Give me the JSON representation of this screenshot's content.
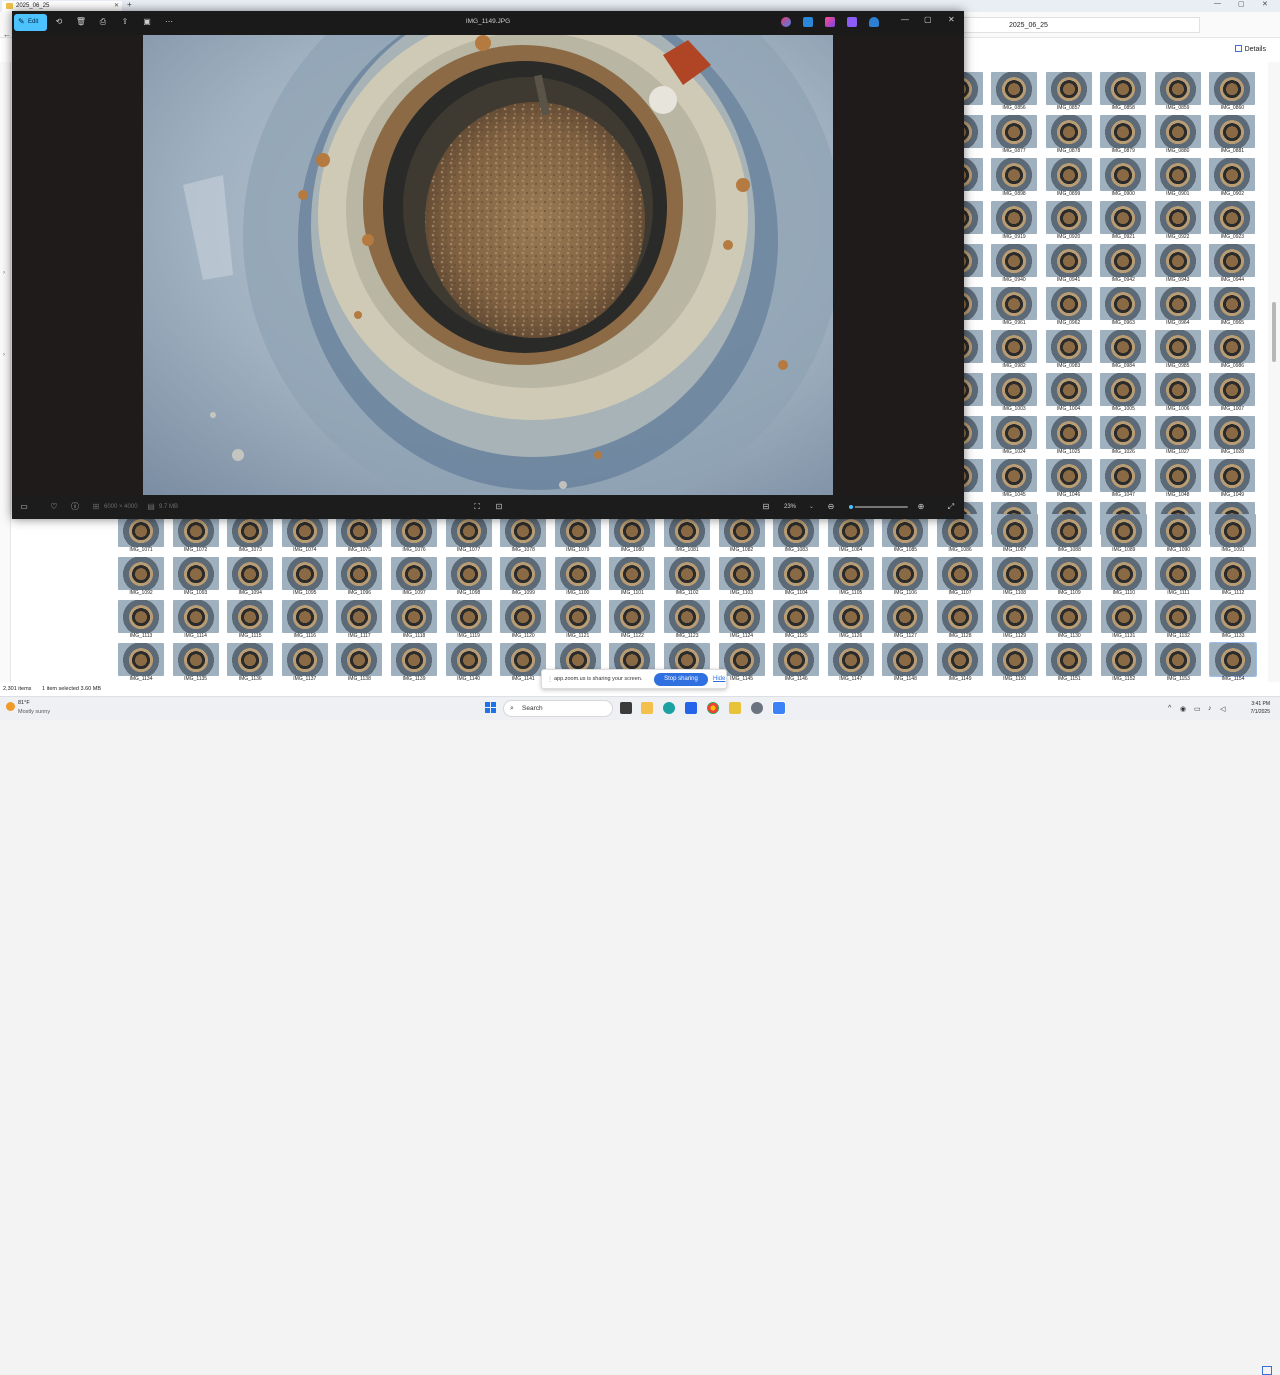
{
  "explorer": {
    "tab_title": "2025_06_25",
    "address_path": "2025_06_25",
    "details_label": "Details",
    "status_count": "2,301 items",
    "status_selected": "1 item selected  3.60 MB",
    "thumbnails_right": [
      [
        "IMG_0856",
        "IMG_0857",
        "IMG_0858",
        "IMG_0859",
        "IMG_0860"
      ],
      [
        "IMG_0877",
        "IMG_0878",
        "IMG_0879",
        "IMG_0880",
        "IMG_0881"
      ],
      [
        "IMG_0898",
        "IMG_0899",
        "IMG_0900",
        "IMG_0901",
        "IMG_0902"
      ],
      [
        "IMG_0919",
        "IMG_0920",
        "IMG_0921",
        "IMG_0922",
        "IMG_0923"
      ],
      [
        "IMG_0940",
        "IMG_0941",
        "IMG_0942",
        "IMG_0943",
        "IMG_0944"
      ],
      [
        "IMG_0961",
        "IMG_0962",
        "IMG_0963",
        "IMG_0964",
        "IMG_0965"
      ],
      [
        "IMG_0982",
        "IMG_0983",
        "IMG_0984",
        "IMG_0985",
        "IMG_0986"
      ],
      [
        "IMG_1003",
        "IMG_1004",
        "IMG_1005",
        "IMG_1006",
        "IMG_1007"
      ],
      [
        "IMG_1024",
        "IMG_1025",
        "IMG_1026",
        "IMG_1027",
        "IMG_1028"
      ],
      [
        "IMG_1045",
        "IMG_1046",
        "IMG_1047",
        "IMG_1048",
        "IMG_1049"
      ],
      [
        "IMG_1066",
        "IMG_1067",
        "IMG_1068",
        "IMG_1069",
        "IMG_1070"
      ]
    ],
    "thumbnails_bottom": [
      [
        "IMG_1071",
        "IMG_1072",
        "IMG_1073",
        "IMG_1074",
        "IMG_1075",
        "IMG_1076",
        "IMG_1077",
        "IMG_1078",
        "IMG_1079",
        "IMG_1080",
        "IMG_1081",
        "IMG_1082",
        "IMG_1083",
        "IMG_1084",
        "IMG_1085",
        "IMG_1086",
        "IMG_1087",
        "IMG_1088",
        "IMG_1089",
        "IMG_1090",
        "IMG_1091"
      ],
      [
        "IMG_1092",
        "IMG_1093",
        "IMG_1094",
        "IMG_1095",
        "IMG_1096",
        "IMG_1097",
        "IMG_1098",
        "IMG_1099",
        "IMG_1100",
        "IMG_1101",
        "IMG_1102",
        "IMG_1103",
        "IMG_1104",
        "IMG_1105",
        "IMG_1106",
        "IMG_1107",
        "IMG_1108",
        "IMG_1109",
        "IMG_1110",
        "IMG_1111",
        "IMG_1112"
      ],
      [
        "IMG_1113",
        "IMG_1114",
        "IMG_1115",
        "IMG_1116",
        "IMG_1117",
        "IMG_1118",
        "IMG_1119",
        "IMG_1120",
        "IMG_1121",
        "IMG_1122",
        "IMG_1123",
        "IMG_1124",
        "IMG_1125",
        "IMG_1126",
        "IMG_1127",
        "IMG_1128",
        "IMG_1129",
        "IMG_1130",
        "IMG_1131",
        "IMG_1132",
        "IMG_1133"
      ],
      [
        "IMG_1134",
        "IMG_1135",
        "IMG_1136",
        "IMG_1137",
        "IMG_1138",
        "IMG_1139",
        "IMG_1140",
        "IMG_1141",
        "IMG_1142",
        "IMG_1143",
        "IMG_1144",
        "IMG_1145",
        "IMG_1146",
        "IMG_1147",
        "IMG_1148",
        "IMG_1149",
        "IMG_1150",
        "IMG_1151",
        "IMG_1152",
        "IMG_1153",
        "IMG_1154"
      ]
    ],
    "selected_thumbnail": "IMG_1154"
  },
  "viewer": {
    "title": "IMG_1149.JPG",
    "edit_label": "Edit",
    "dimensions": "6000 × 4000",
    "file_size": "9.7 MB",
    "zoom_level": "23%",
    "zoom_fraction": 0.05,
    "icons": {
      "edit": "edit-icon",
      "rotate": "rotate-icon",
      "delete": "delete-icon",
      "print": "print-icon",
      "share": "share-icon",
      "slideshow": "slideshow-icon",
      "more": "more-icon",
      "minimize": "minimize-icon",
      "maximize": "maximize-icon",
      "close": "close-icon"
    }
  },
  "share_banner": {
    "message": "app.zoom.us is sharing your screen.",
    "stop_label": "Stop sharing",
    "hide_label": "Hide"
  },
  "taskbar": {
    "weather_temp": "81°F",
    "weather_desc": "Mostly sunny",
    "search_placeholder": "Search",
    "time": "3:41 PM",
    "date": "7/1/2025"
  },
  "colors": {
    "accent": "#4cc2ff",
    "zoom_blue": "#2f6fe0"
  }
}
